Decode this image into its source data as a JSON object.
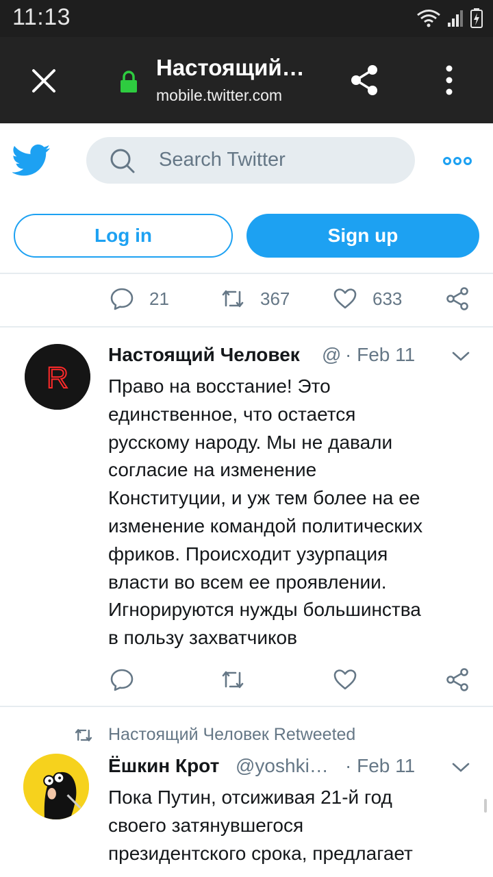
{
  "status_bar": {
    "time": "11:13"
  },
  "browser": {
    "title": "Настоящий…",
    "url": "mobile.twitter.com"
  },
  "twitter": {
    "search_placeholder": "Search Twitter",
    "login_label": "Log in",
    "signup_label": "Sign up"
  },
  "prev_tweet_actions": {
    "replies": "21",
    "retweets": "367",
    "likes": "633"
  },
  "tweet1": {
    "author_name": "Настоящий Человек",
    "handle": "@",
    "date": "· Feb 11",
    "avatar_letter": "R",
    "lines": [
      "Право на восстание! Это",
      "единственное, что остается",
      "русскому народу. Мы не давали",
      "согласие на изменение",
      "Конституции, и уж тем более на ее",
      "изменение командой политических",
      "фриков. Происходит узурпация",
      "власти во всем ее проявлении.",
      "Игнорируются нужды большинства",
      "в пользу захватчиков"
    ]
  },
  "tweet2": {
    "retweeted_by": "Настоящий Человек Retweeted",
    "author_name": "Ёшкин Крот",
    "handle": "@yoshki…",
    "date": "· Feb 11",
    "lines": [
      "Пока Путин, отсиживая 21-й год",
      "своего затянувшегося",
      "президентского срока, предлагает"
    ]
  },
  "colors": {
    "accent": "#1da1f2",
    "secure_lock": "#2ecc40",
    "muted": "#657786"
  },
  "icons": [
    "close-icon",
    "lock-icon",
    "share-icon",
    "menu-icon",
    "twitter-bird-icon",
    "search-icon",
    "more-icon",
    "reply-icon",
    "retweet-icon",
    "like-icon",
    "share-tweet-icon",
    "chevron-down-icon"
  ]
}
